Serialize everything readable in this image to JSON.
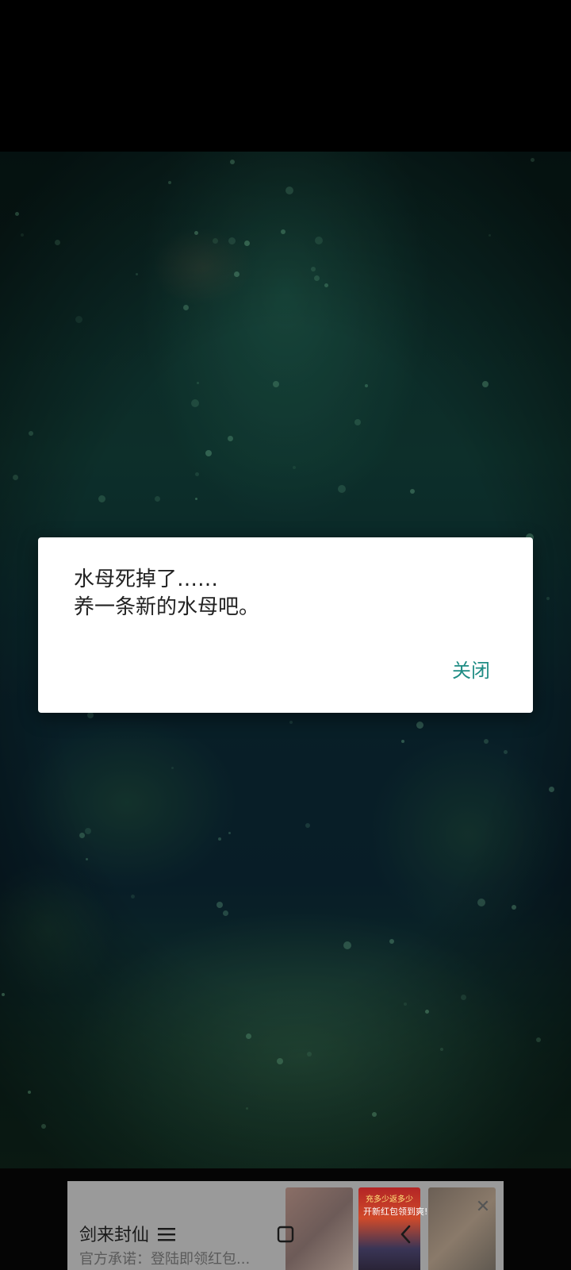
{
  "dialog": {
    "message_line1": "水母死掉了……",
    "message_line2": "养一条新的水母吧。",
    "close_label": "关闭"
  },
  "ad": {
    "title": "剑来封仙",
    "subtitle": "官方承诺：登陆即领红包...",
    "thumb_caption_line1": "充多少返多少",
    "thumb_caption_line2": "开新红包领到爽!"
  },
  "nav": {
    "menu_icon": "menu-icon",
    "home_icon": "home-icon",
    "back_icon": "back-icon"
  },
  "colors": {
    "accent": "#1f8c84",
    "dialog_bg": "#ffffff",
    "scene_base": "#0e2f2c"
  }
}
